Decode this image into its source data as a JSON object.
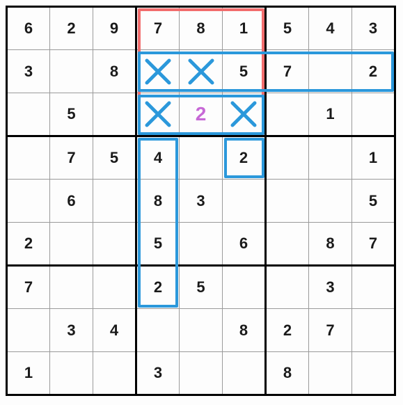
{
  "sudoku": {
    "size": 9,
    "rows": [
      [
        {
          "v": "6"
        },
        {
          "v": "2"
        },
        {
          "v": "9"
        },
        {
          "v": "7"
        },
        {
          "v": "8"
        },
        {
          "v": "1"
        },
        {
          "v": "5"
        },
        {
          "v": "4"
        },
        {
          "v": "3"
        }
      ],
      [
        {
          "v": "3"
        },
        {
          "v": ""
        },
        {
          "v": "8"
        },
        {
          "x": true
        },
        {
          "x": true
        },
        {
          "v": "5"
        },
        {
          "v": "7"
        },
        {
          "v": ""
        },
        {
          "v": "2"
        }
      ],
      [
        {
          "v": ""
        },
        {
          "v": "5"
        },
        {
          "v": ""
        },
        {
          "x": true
        },
        {
          "v": "2",
          "hl": true
        },
        {
          "x": true
        },
        {
          "v": ""
        },
        {
          "v": "1"
        },
        {
          "v": ""
        }
      ],
      [
        {
          "v": ""
        },
        {
          "v": "7"
        },
        {
          "v": "5"
        },
        {
          "v": "4"
        },
        {
          "v": ""
        },
        {
          "v": "2"
        },
        {
          "v": ""
        },
        {
          "v": ""
        },
        {
          "v": "1"
        }
      ],
      [
        {
          "v": ""
        },
        {
          "v": "6"
        },
        {
          "v": ""
        },
        {
          "v": "8"
        },
        {
          "v": "3"
        },
        {
          "v": ""
        },
        {
          "v": ""
        },
        {
          "v": ""
        },
        {
          "v": "5"
        }
      ],
      [
        {
          "v": "2"
        },
        {
          "v": ""
        },
        {
          "v": ""
        },
        {
          "v": "5"
        },
        {
          "v": ""
        },
        {
          "v": "6"
        },
        {
          "v": ""
        },
        {
          "v": "8"
        },
        {
          "v": "7"
        }
      ],
      [
        {
          "v": "7"
        },
        {
          "v": ""
        },
        {
          "v": ""
        },
        {
          "v": "2"
        },
        {
          "v": "5"
        },
        {
          "v": ""
        },
        {
          "v": ""
        },
        {
          "v": "3"
        },
        {
          "v": ""
        }
      ],
      [
        {
          "v": ""
        },
        {
          "v": "3"
        },
        {
          "v": "4"
        },
        {
          "v": ""
        },
        {
          "v": ""
        },
        {
          "v": "8"
        },
        {
          "v": "2"
        },
        {
          "v": "7"
        },
        {
          "v": ""
        }
      ],
      [
        {
          "v": "1"
        },
        {
          "v": ""
        },
        {
          "v": ""
        },
        {
          "v": "3"
        },
        {
          "v": ""
        },
        {
          "v": ""
        },
        {
          "v": "8"
        },
        {
          "v": ""
        },
        {
          "v": ""
        }
      ]
    ]
  },
  "regions": [
    {
      "name": "red-box-top-middle",
      "color": "red",
      "rects": [
        {
          "r0": 0,
          "c0": 3,
          "r1": 2,
          "c1": 5
        }
      ]
    },
    {
      "name": "blue-row-2",
      "color": "blue",
      "rects": [
        {
          "r0": 1,
          "c0": 3,
          "r1": 1,
          "c1": 8
        }
      ]
    },
    {
      "name": "blue-row-3",
      "color": "blue",
      "rects": [
        {
          "r0": 2,
          "c0": 3,
          "r1": 2,
          "c1": 5
        }
      ]
    },
    {
      "name": "blue-col-4",
      "color": "blue",
      "rects": [
        {
          "r0": 3,
          "c0": 3,
          "r1": 6,
          "c1": 3
        }
      ]
    },
    {
      "name": "blue-r4c6",
      "color": "blue",
      "rects": [
        {
          "r0": 3,
          "c0": 5,
          "r1": 3,
          "c1": 5
        }
      ]
    }
  ],
  "colors": {
    "red": "#f26d6d",
    "blue": "#2b98db",
    "highlight": "#c768d6"
  }
}
